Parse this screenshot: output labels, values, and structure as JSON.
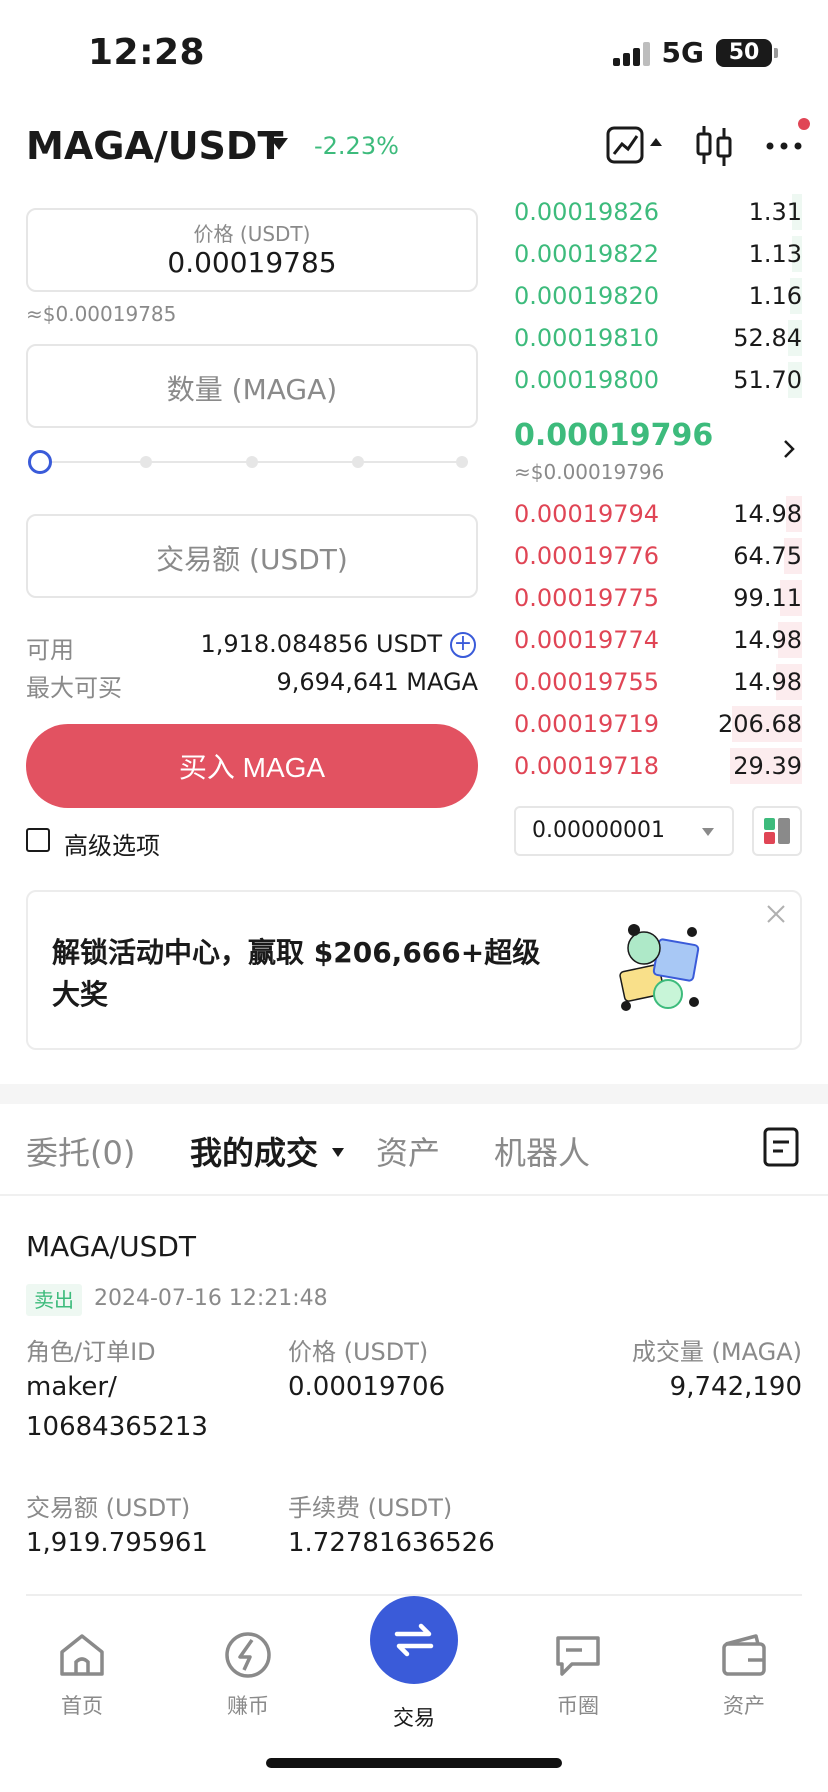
{
  "status": {
    "time": "12:28",
    "network": "5G",
    "battery": "50"
  },
  "header": {
    "pair": "MAGA/USDT",
    "change": "-2.23%",
    "colors": {
      "up": "#3dbb7c",
      "down": "#e04555",
      "accent": "#3a5bd9",
      "buy": "#e25261"
    }
  },
  "form": {
    "price_label": "价格 (USDT)",
    "price_value": "0.00019785",
    "price_approx": "≈$0.00019785",
    "qty_placeholder": "数量 (MAGA)",
    "amount_placeholder": "交易额 (USDT)",
    "slider_level": 0,
    "available_label": "可用",
    "available_value": "1,918.084856 USDT",
    "max_buy_label": "最大可买",
    "max_buy_value": "9,694,641 MAGA",
    "buy_button": "买入 MAGA",
    "advanced_label": "高级选项"
  },
  "orderbook": {
    "asks": [
      {
        "price": "0.00019826",
        "qty": "1.31"
      },
      {
        "price": "0.00019822",
        "qty": "1.13"
      },
      {
        "price": "0.00019820",
        "qty": "1.16"
      },
      {
        "price": "0.00019810",
        "qty": "52.84"
      },
      {
        "price": "0.00019800",
        "qty": "51.70"
      }
    ],
    "last_price": "0.00019796",
    "last_approx": "≈$0.00019796",
    "bids": [
      {
        "price": "0.00019794",
        "qty": "14.98"
      },
      {
        "price": "0.00019776",
        "qty": "64.75"
      },
      {
        "price": "0.00019775",
        "qty": "99.11"
      },
      {
        "price": "0.00019774",
        "qty": "14.98"
      },
      {
        "price": "0.00019755",
        "qty": "14.98"
      },
      {
        "price": "0.00019719",
        "qty": "206.68"
      },
      {
        "price": "0.00019718",
        "qty": "29.39"
      }
    ],
    "precision": "0.00000001"
  },
  "promo": {
    "text": "解锁活动中心，赢取 $206,666+超级大奖"
  },
  "tabs": {
    "orders": "委托(0)",
    "trades": "我的成交",
    "assets": "资产",
    "bots": "机器人"
  },
  "trade": {
    "pair": "MAGA/USDT",
    "side": "卖出",
    "time": "2024-07-16 12:21:48",
    "role_label": "角色/订单ID",
    "role_value_1": "maker/",
    "role_value_2": "10684365213",
    "price_label": "价格 (USDT)",
    "price_value": "0.00019706",
    "volume_label": "成交量 (MAGA)",
    "volume_value": "9,742,190",
    "amount_label": "交易额 (USDT)",
    "amount_value": "1,919.795961",
    "fee_label": "手续费 (USDT)",
    "fee_value": "1.72781636526"
  },
  "nav": {
    "home": "首页",
    "earn": "赚币",
    "trade": "交易",
    "square": "币圈",
    "assets": "资产"
  }
}
